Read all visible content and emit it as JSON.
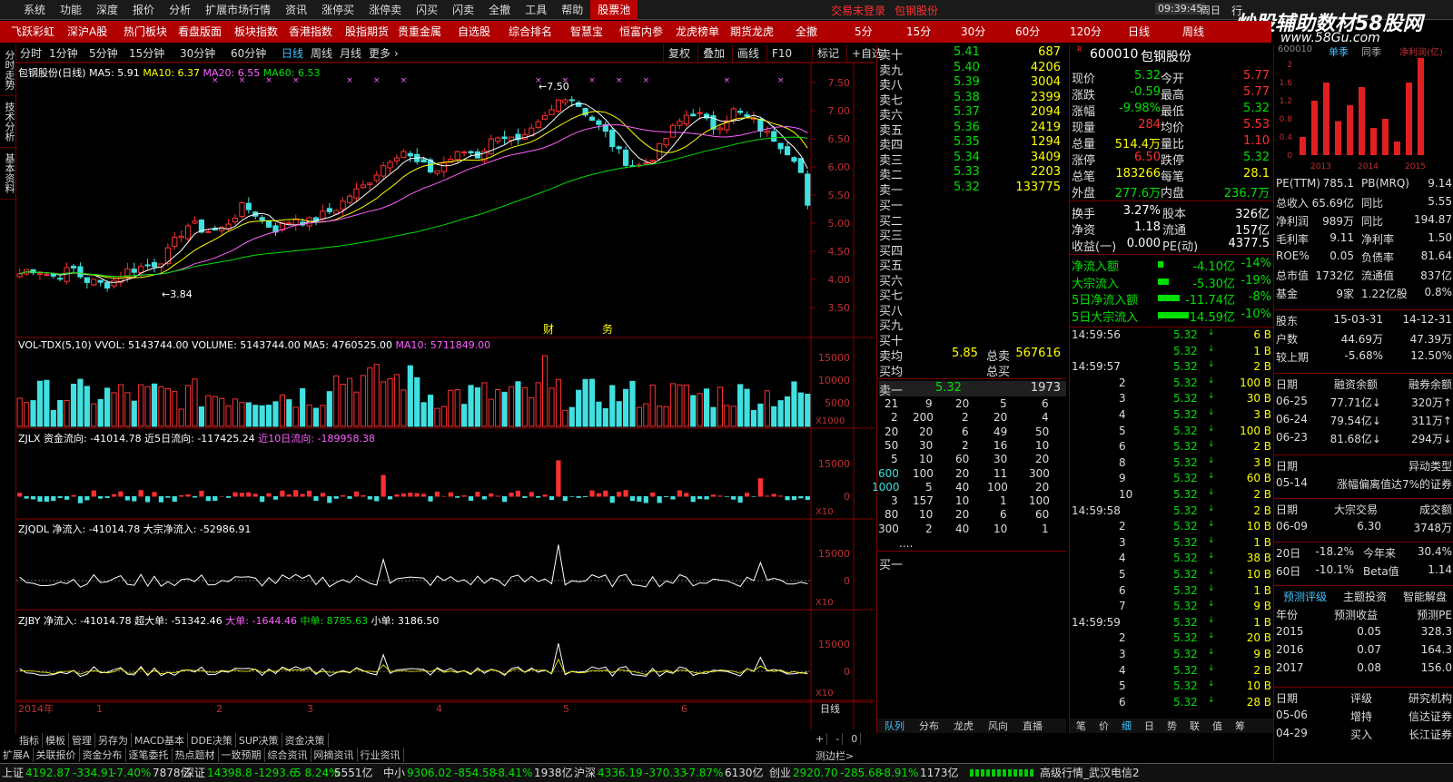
{
  "menu": {
    "items": [
      "系统",
      "功能",
      "深度",
      "报价",
      "分析",
      "扩展市场行情",
      "资讯",
      "涨停买",
      "涨停卖",
      "闪买",
      "闪卖",
      "全撤",
      "工具",
      "帮助"
    ],
    "active": "股票池",
    "notice": "交易未登录",
    "stock_title": "包钢股份",
    "time": "09:39:45",
    "weekday": "周日",
    "right": "行"
  },
  "watermark": {
    "line1": "炒股辅助数材58股网",
    "line2": "www.58Gu.com"
  },
  "subbar": {
    "items": [
      "飞跃彩虹",
      "深沪A股",
      "热门板块",
      "看盘版面",
      "板块指数",
      "香港指数",
      "股指期货",
      "贵重金属",
      "自选股",
      "综合排名",
      "智慧宝",
      "恒富内参",
      "龙虎榜单",
      "期货龙虎",
      "全撤",
      "5分",
      "15分",
      "30分",
      "60分",
      "120分",
      "日线",
      "周线"
    ]
  },
  "toolbar": {
    "periods": [
      "分时",
      "1分钟",
      "5分钟",
      "15分钟",
      "30分钟",
      "60分钟",
      "日线",
      "周线",
      "月线",
      "更多"
    ],
    "active_period": "日线",
    "actions": [
      "复权",
      "叠加",
      "画线",
      "F10",
      "标记",
      "+自选"
    ]
  },
  "sidetabs": [
    "分时走势",
    "技术分析",
    "基本资料"
  ],
  "chart": {
    "price_title": "包钢股份(日线)",
    "ma5": "MA5: 5.91",
    "ma10": "MA10: 6.37",
    "ma20": "MA20: 6.55",
    "ma60": "MA60: 6.53",
    "high_label": "7.50",
    "low_label": "3.84",
    "fin_label1": "财",
    "fin_label2": "务",
    "price_ticks": [
      "7.50",
      "7.00",
      "6.50",
      "6.00",
      "5.50",
      "5.00",
      "4.50",
      "4.00",
      "3.50"
    ],
    "vol_title": "VOL-TDX(5,10)",
    "vol_vvol": "VVOL: 5143744.00",
    "vol_volume": "VOLUME: 5143744.00",
    "vol_ma5": "MA5: 4760525.00",
    "vol_ma10": "MA10: 5711849.00",
    "vol_ticks": [
      "15000",
      "10000",
      "5000"
    ],
    "vol_unit": "X1000",
    "zjlx_title": "ZJLX",
    "zjlx_1": "资金流向: -41014.78",
    "zjlx_2": "近5日流向: -117425.24",
    "zjlx_3": "近10日流向: -189958.38",
    "zjlx_ticks": [
      "15000",
      "0"
    ],
    "zjlx_unit": "X10",
    "zjqdl_title": "ZJQDL",
    "zjqdl_1": "净流入: -41014.78",
    "zjqdl_2": "大宗净流入: -52986.91",
    "zjqdl_ticks": [
      "15000",
      "0"
    ],
    "zjqdl_unit": "X10",
    "zjby_title": "ZJBY",
    "zjby_1": "净流入: -41014.78",
    "zjby_2": "超大单: -51342.46",
    "zjby_3": "大单: -1644.46",
    "zjby_4": "中单: 8785.63",
    "zjby_5": "小单: 3186.50",
    "zjby_ticks": [
      "15000",
      "0"
    ],
    "zjby_unit": "X10",
    "x_labels": [
      "2014年",
      "1",
      "2",
      "3",
      "4",
      "5",
      "6"
    ],
    "period_label": "日线"
  },
  "bottomtabs": [
    "指标",
    "模板",
    "管理",
    "另存为",
    "MACD基本",
    "DDE决策",
    "SUP决策",
    "资金决策"
  ],
  "bottomtabs2": [
    "扩展A",
    "关联报价",
    "资金分布",
    "逐笔委托",
    "热点题材",
    "一致预期",
    "综合资讯",
    "网摘资讯",
    "行业资讯"
  ],
  "bottomright": {
    "label": "测边栏>",
    "buttons": [
      "+",
      "-",
      "0"
    ]
  },
  "orderbook": {
    "sells": [
      [
        "卖十",
        "5.41",
        "687"
      ],
      [
        "卖九",
        "5.40",
        "4206"
      ],
      [
        "卖八",
        "5.39",
        "3004"
      ],
      [
        "卖七",
        "5.38",
        "2399"
      ],
      [
        "卖六",
        "5.37",
        "2094"
      ],
      [
        "卖五",
        "5.36",
        "2419"
      ],
      [
        "卖四",
        "5.35",
        "1294"
      ],
      [
        "卖三",
        "5.34",
        "3409"
      ],
      [
        "卖二",
        "5.33",
        "2203"
      ],
      [
        "卖一",
        "5.32",
        "133775"
      ]
    ],
    "buys": [
      "买一",
      "买二",
      "买三",
      "买四",
      "买五",
      "买六",
      "买七",
      "买八",
      "买九",
      "买十"
    ],
    "avg_sell_label": "卖均",
    "avg_sell": "5.85",
    "total_sell_label": "总卖",
    "total_sell": "567616",
    "avg_buy_label": "买均",
    "total_buy_label": "总买",
    "queue_label": "卖一",
    "queue_price": "5.32",
    "queue_vol": "1973",
    "queue": [
      [
        "21",
        "9",
        "20",
        "5",
        "6"
      ],
      [
        "2",
        "200",
        "2",
        "20",
        "4"
      ],
      [
        "20",
        "20",
        "6",
        "49",
        "50"
      ],
      [
        "50",
        "30",
        "2",
        "16",
        "10"
      ],
      [
        "5",
        "10",
        "60",
        "30",
        "20"
      ],
      [
        "600",
        "100",
        "20",
        "11",
        "300"
      ],
      [
        "1000",
        "5",
        "40",
        "100",
        "20"
      ],
      [
        "3",
        "157",
        "10",
        "1",
        "100"
      ],
      [
        "80",
        "10",
        "20",
        "6",
        "60"
      ],
      [
        "300",
        "2",
        "40",
        "10",
        "1"
      ]
    ],
    "queue_more": "....",
    "queue_buy_label": "买一",
    "tabs": [
      "队列",
      "分布",
      "龙虎",
      "风向",
      "直播"
    ]
  },
  "quote": {
    "code": "600010",
    "name": "包钢股份",
    "badge": "R",
    "rows": [
      [
        "现价",
        "5.32",
        "今开",
        "5.77"
      ],
      [
        "涨跌",
        "-0.59",
        "最高",
        "5.77"
      ],
      [
        "涨幅",
        "-9.98%",
        "最低",
        "5.32"
      ],
      [
        "现量",
        "284",
        "均价",
        "5.53"
      ],
      [
        "总量",
        "514.4万",
        "量比",
        "1.10"
      ],
      [
        "涨停",
        "6.50",
        "跌停",
        "5.32"
      ],
      [
        "总笔",
        "183266",
        "每笔",
        "28.1"
      ],
      [
        "外盘",
        "277.6万",
        "内盘",
        "236.7万"
      ]
    ],
    "rows2": [
      [
        "换手",
        "3.27%",
        "股本",
        "326亿"
      ],
      [
        "净资",
        "1.18",
        "流通",
        "157亿"
      ],
      [
        "收益(一)",
        "0.000",
        "PE(动)",
        "4377.5"
      ]
    ],
    "flows": [
      [
        "净流入额",
        "-4.10亿",
        "-14%"
      ],
      [
        "大宗流入",
        "-5.30亿",
        "-19%"
      ],
      [
        "5日净流入额",
        "-11.74亿",
        "-8%"
      ],
      [
        "5日大宗流入",
        "-14.59亿",
        "-10%"
      ]
    ],
    "ticks": [
      [
        "14:59:56",
        "5.32",
        "6",
        "B"
      ],
      [
        "",
        "5.32",
        "1",
        "B"
      ],
      [
        "14:59:57",
        "5.32",
        "2",
        "B"
      ],
      [
        "2",
        "5.32",
        "100",
        "B"
      ],
      [
        "3",
        "5.32",
        "30",
        "B"
      ],
      [
        "4",
        "5.32",
        "3",
        "B"
      ],
      [
        "5",
        "5.32",
        "100",
        "B"
      ],
      [
        "6",
        "5.32",
        "2",
        "B"
      ],
      [
        "8",
        "5.32",
        "3",
        "B"
      ],
      [
        "9",
        "5.32",
        "60",
        "B"
      ],
      [
        "10",
        "5.32",
        "2",
        "B"
      ],
      [
        "14:59:58",
        "5.32",
        "2",
        "B"
      ],
      [
        "2",
        "5.32",
        "10",
        "B"
      ],
      [
        "3",
        "5.32",
        "1",
        "B"
      ],
      [
        "4",
        "5.32",
        "38",
        "B"
      ],
      [
        "5",
        "5.32",
        "10",
        "B"
      ],
      [
        "6",
        "5.32",
        "1",
        "B"
      ],
      [
        "7",
        "5.32",
        "9",
        "B"
      ],
      [
        "14:59:59",
        "5.32",
        "1",
        "B"
      ],
      [
        "2",
        "5.32",
        "20",
        "B"
      ],
      [
        "3",
        "5.32",
        "9",
        "B"
      ],
      [
        "4",
        "5.32",
        "2",
        "B"
      ],
      [
        "5",
        "5.32",
        "10",
        "B"
      ],
      [
        "6",
        "5.32",
        "28",
        "B"
      ]
    ],
    "tabs": [
      "笔",
      "价",
      "细",
      "日",
      "势",
      "联",
      "值",
      "筹"
    ]
  },
  "f10": {
    "code": "600010",
    "tab1": "单季",
    "tab2": "同季",
    "legend": "净利润(亿)",
    "bar_years": [
      "2013",
      "2014",
      "2015"
    ],
    "bar_values": [
      0.4,
      1.2,
      1.6,
      0.75,
      1.1,
      1.5,
      0.6,
      0.8,
      0.3,
      1.6,
      2.3
    ],
    "bar_ticks": [
      "2",
      "1.6",
      "1.2",
      "0.8",
      "0.4",
      "0"
    ],
    "rows": [
      [
        "PE(TTM)",
        "785.1",
        "PB(MRQ)",
        "9.14"
      ],
      [
        "总收入",
        "65.69亿",
        "同比",
        "5.55"
      ],
      [
        "净利润",
        "989万",
        "同比",
        "194.87"
      ],
      [
        "毛利率",
        "9.11",
        "净利率",
        "1.50"
      ],
      [
        "ROE%",
        "0.05",
        "负债率",
        "81.64"
      ],
      [
        "总市值",
        "1732亿",
        "流通值",
        "837亿"
      ],
      [
        "基金",
        "9家",
        "1.22亿股",
        "0.8%"
      ]
    ],
    "holders": [
      [
        "股东",
        "15-03-31",
        "14-12-31"
      ],
      [
        "户数",
        "44.69万",
        "47.39万"
      ],
      [
        "较上期",
        "-5.68%",
        "12.50%"
      ]
    ],
    "margin_head": [
      "日期",
      "融资余额",
      "融券余额"
    ],
    "margin": [
      [
        "06-25",
        "77.71亿↓",
        "320万↑"
      ],
      [
        "06-24",
        "79.54亿↓",
        "311万↑"
      ],
      [
        "06-23",
        "81.68亿↓",
        "294万↓"
      ]
    ],
    "abn_head": [
      "日期",
      "异动类型"
    ],
    "abn": [
      [
        "05-14",
        "涨幅偏离值达7%的证券"
      ]
    ],
    "block_head": [
      "日期",
      "大宗交易",
      "成交额"
    ],
    "block": [
      [
        "06-09",
        "6.30",
        "3748万"
      ]
    ],
    "perf": [
      [
        "20日",
        "-18.2%",
        "今年来",
        "30.4%"
      ],
      [
        "60日",
        "-10.1%",
        "Beta值",
        "1.14"
      ]
    ],
    "fc_tabs": [
      "预测评级",
      "主题投资",
      "智能解盘"
    ],
    "fc_head": [
      "年份",
      "预测收益",
      "预测PE"
    ],
    "fc": [
      [
        "2015",
        "0.05",
        "328.3"
      ],
      [
        "2016",
        "0.07",
        "164.3"
      ],
      [
        "2017",
        "0.08",
        "156.0"
      ]
    ],
    "rating_head": [
      "日期",
      "评级",
      "研究机构"
    ],
    "ratings": [
      [
        "05-06",
        "增持",
        "信达证券"
      ],
      [
        "04-29",
        "买入",
        "长江证券"
      ]
    ]
  },
  "status": {
    "sh": "上证",
    "sh_v": "4192.87",
    "sh_c": "-334.91",
    "sh_p": "-7.40%",
    "sh_a": "7878亿",
    "sz": "深证",
    "sz_v": "14398.8",
    "sz_c": "-1293.6",
    "sz_p": "5 8.24%",
    "sz_a": "5551亿",
    "zx": "中小",
    "zx_v": "9306.02",
    "zx_c": "-854.58",
    "zx_p": "-8.41%",
    "zx_a": "1938亿",
    "hs": "沪深",
    "hs_v": "4336.19",
    "hs_c": "-370.33",
    "hs_p": "-7.87%",
    "hs_a": "6130亿",
    "cy": "创业",
    "cy_v": "2920.70",
    "cy_c": "-285.68",
    "cy_p": "-8.91%",
    "cy_a": "1173亿",
    "server": "高级行情_武汉电信2"
  }
}
